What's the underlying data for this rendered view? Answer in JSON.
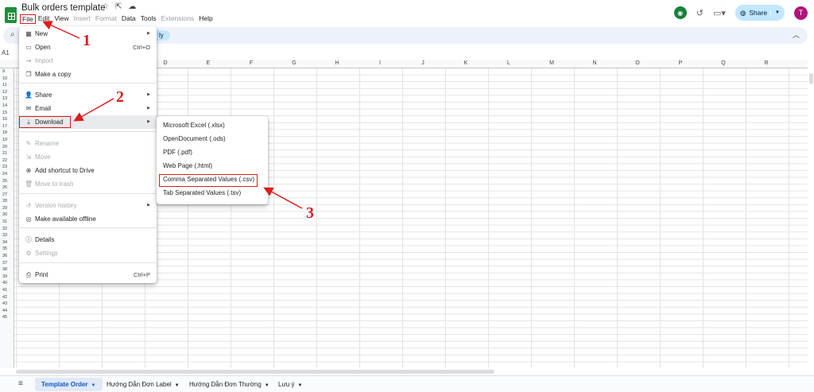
{
  "window": {
    "title": "Bulk orders template"
  },
  "menubar": [
    "File",
    "Edit",
    "View",
    "Insert",
    "Format",
    "Data",
    "Tools",
    "Extensions",
    "Help"
  ],
  "menubar_disabled": [
    "Insert",
    "Format",
    "Extensions"
  ],
  "header": {
    "share_label": "Share",
    "avatar_initial": "T"
  },
  "toolbar": {
    "chip_label": "ly"
  },
  "namebox": "A1",
  "columns": [
    "D",
    "E",
    "F",
    "G",
    "H",
    "I",
    "J",
    "K",
    "L",
    "M",
    "N",
    "O",
    "P",
    "Q",
    "R"
  ],
  "rows": [
    "9",
    "10",
    "11",
    "12",
    "13",
    "14",
    "15",
    "16",
    "17",
    "18",
    "19",
    "20",
    "21",
    "22",
    "23",
    "24",
    "25",
    "26",
    "27",
    "28",
    "29",
    "30",
    "31",
    "32",
    "33",
    "34",
    "35",
    "36",
    "37",
    "38",
    "39",
    "40",
    "41",
    "42",
    "43",
    "44",
    "45"
  ],
  "file_menu": {
    "items": [
      {
        "label": "New",
        "icon": "new-sheet-icon",
        "arrow": true
      },
      {
        "label": "Open",
        "icon": "folder-icon",
        "shortcut": "Ctrl+O"
      },
      {
        "label": "Import",
        "icon": "import-icon",
        "disabled": true
      },
      {
        "label": "Make a copy",
        "icon": "copy-icon"
      },
      {
        "label": "Share",
        "icon": "person-add-icon",
        "arrow": true
      },
      {
        "label": "Email",
        "icon": "email-icon",
        "arrow": true
      },
      {
        "label": "Download",
        "icon": "download-icon",
        "arrow": true,
        "highlighted": true
      },
      {
        "label": "Rename",
        "icon": "rename-icon",
        "disabled": true
      },
      {
        "label": "Move",
        "icon": "move-icon",
        "disabled": true
      },
      {
        "label": "Add shortcut to Drive",
        "icon": "drive-shortcut-icon"
      },
      {
        "label": "Move to trash",
        "icon": "trash-icon",
        "disabled": true
      },
      {
        "label": "Version history",
        "icon": "history-icon",
        "arrow": true,
        "disabled": true
      },
      {
        "label": "Make available offline",
        "icon": "offline-icon"
      },
      {
        "label": "Details",
        "icon": "info-icon"
      },
      {
        "label": "Settings",
        "icon": "settings-icon",
        "disabled": true
      },
      {
        "label": "Print",
        "icon": "print-icon",
        "shortcut": "Ctrl+P"
      }
    ]
  },
  "download_menu": {
    "items": [
      "Microsoft Excel (.xlsx)",
      "OpenDocument (.ods)",
      "PDF (.pdf)",
      "Web Page (.html)",
      "Comma Separated Values (.csv)",
      "Tab Separated Values (.tsv)"
    ]
  },
  "sheet_tabs": [
    "Template Order",
    "Hướng Dẫn Đơn Label",
    "Hướng Dẫn Đơn Thường",
    "Lưu ý"
  ],
  "annotations": [
    "1",
    "2",
    "3"
  ],
  "colors": {
    "annotation_red": "#e01b1b",
    "share_bg": "#c2e7ff",
    "sheets_green": "#1e8e3e"
  }
}
